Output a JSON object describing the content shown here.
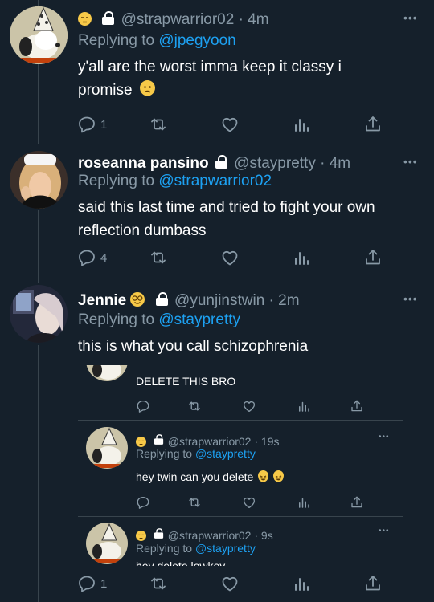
{
  "tweet1": {
    "handle": "@strapwarrior02",
    "sep": "·",
    "time": "4m",
    "replying_label": "Replying to",
    "replying_handle": "@jpegyoon",
    "text": "y'all are the worst imma keep it classy i promise",
    "reply_count": "1"
  },
  "tweet2": {
    "name": "roseanna pansino",
    "handle": "@staypretty",
    "sep": "·",
    "time": "4m",
    "replying_label": "Replying to",
    "replying_handle": "@strapwarrior02",
    "text": "said this last time and tried to fight your own reflection dumbass",
    "reply_count": "4"
  },
  "tweet3": {
    "name": "Jennie",
    "handle": "@yunjinstwin",
    "sep": "·",
    "time": "2m",
    "replying_label": "Replying to",
    "replying_handle": "@staypretty",
    "text": "this is what you call schizophrenia",
    "embedded": {
      "tweet_a": {
        "text": "DELETE THIS BRO"
      },
      "tweet_b": {
        "handle": "@strapwarrior02",
        "sep": "·",
        "time": "19s",
        "replying_label": "Replying to",
        "replying_handle": "@staypretty",
        "text": "hey twin can you delete"
      },
      "tweet_c": {
        "handle": "@strapwarrior02",
        "sep": "·",
        "time": "9s",
        "replying_label": "Replying to",
        "replying_handle": "@staypretty",
        "text": "hey delete lowkey"
      }
    },
    "reply_count": "1"
  },
  "icons": [
    "reply-icon",
    "retweet-icon",
    "like-icon",
    "analytics-icon",
    "share-icon",
    "more-icon",
    "lock-icon"
  ],
  "colors": {
    "background": "#15202b",
    "muted": "#8899a6",
    "link": "#1da1f2",
    "divider": "#38444d"
  }
}
